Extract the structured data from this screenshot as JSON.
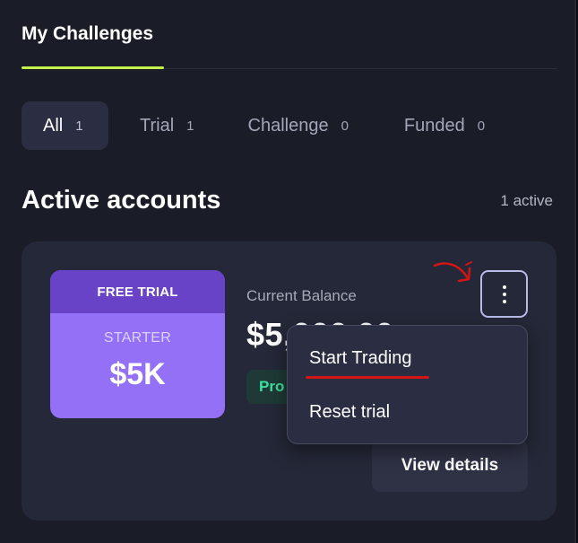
{
  "tabs": [
    {
      "label": "My Challenges",
      "active": true
    }
  ],
  "filters": [
    {
      "label": "All",
      "count": "1",
      "active": true
    },
    {
      "label": "Trial",
      "count": "1"
    },
    {
      "label": "Challenge",
      "count": "0"
    },
    {
      "label": "Funded",
      "count": "0"
    }
  ],
  "section": {
    "title": "Active accounts",
    "count_text": "1 active"
  },
  "account": {
    "plan_type": "FREE TRIAL",
    "tier": "STARTER",
    "size": "$5K",
    "balance_label": "Current Balance",
    "balance_value": "$5,000.00",
    "status": "Pro",
    "view_label": "View details"
  },
  "menu": {
    "items": [
      "Start Trading",
      "Reset trial"
    ]
  },
  "colors": {
    "accent": "#c5f24a",
    "plan_header": "#6943c7",
    "plan_body": "#9370f5",
    "status_text": "#3ee0a0",
    "annotation": "#d31515"
  },
  "icons": {
    "menu": "kebab-vertical-icon",
    "annotation": "hand-drawn-arrow-icon"
  }
}
